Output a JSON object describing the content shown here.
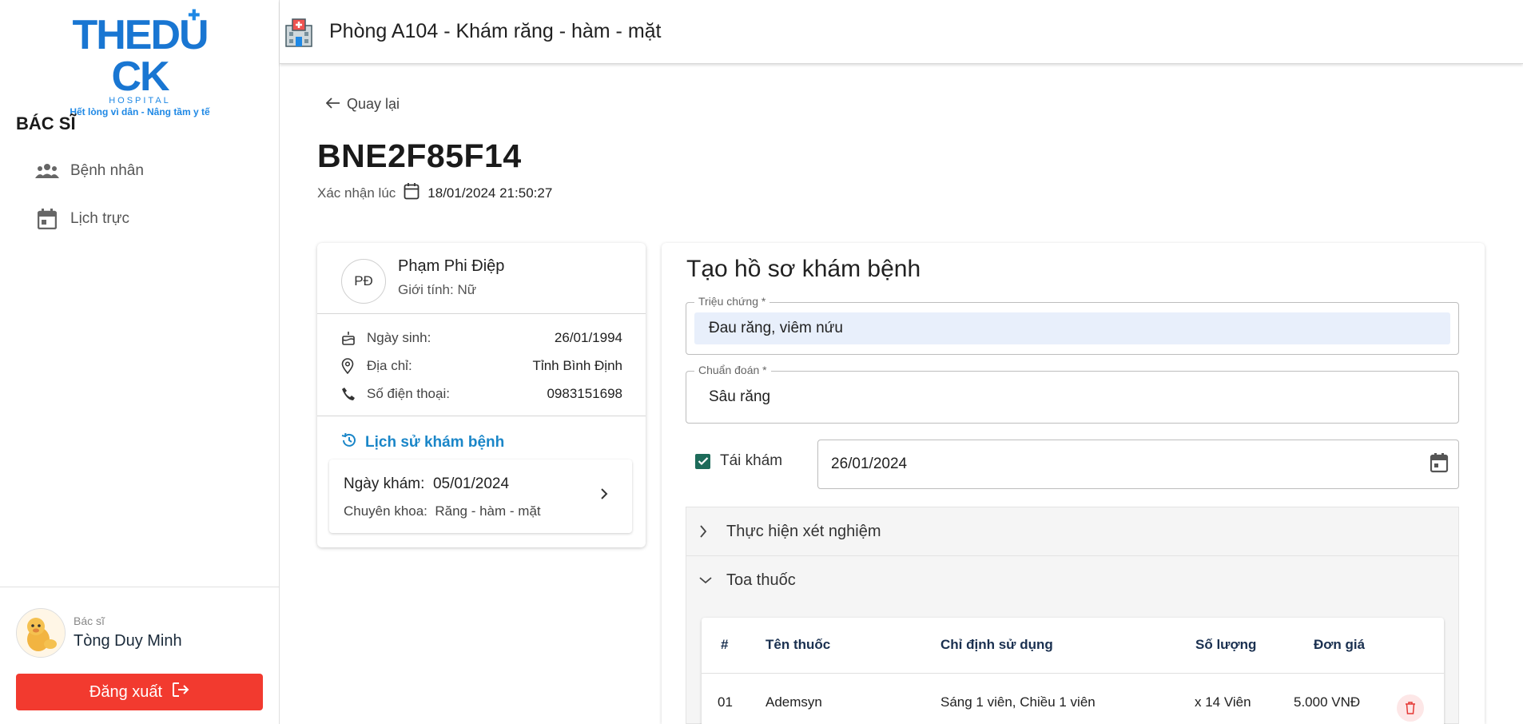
{
  "logo": {
    "main_the": "THE",
    "main_d": "D",
    "main_u": "U",
    "main_ck": "CK",
    "sub": "HOSPITAL",
    "slogan": "Hết lòng vì dân - Nâng tầm y tế"
  },
  "sidebar": {
    "role": "BÁC SĨ",
    "items": [
      {
        "label": "Bệnh nhân",
        "icon": "people-icon"
      },
      {
        "label": "Lịch trực",
        "icon": "calendar-icon"
      }
    ],
    "user": {
      "role": "Bác sĩ",
      "name": "Tòng Duy Minh"
    },
    "logout_label": "Đăng xuất"
  },
  "header": {
    "title": "Phòng A104 - Khám răng - hàm - mặt",
    "icon": "hospital-icon"
  },
  "page": {
    "back_label": "Quay lại",
    "code": "BNE2F85F14",
    "confirm_label": "Xác nhận lúc",
    "confirm_datetime": "18/01/2024 21:50:27"
  },
  "patient": {
    "initials": "PĐ",
    "name": "Phạm Phi Điệp",
    "gender": "Giới tính: Nữ",
    "dob_label": "Ngày sinh:",
    "dob": "26/01/1994",
    "address_label": "Địa chỉ:",
    "address": "Tỉnh Bình Định",
    "phone_label": "Số điện thoại:",
    "phone": "0983151698",
    "history_title": "Lịch sử khám bệnh",
    "history": [
      {
        "date_label": "Ngày khám:",
        "date": "05/01/2024",
        "spec_label": "Chuyên khoa:",
        "spec": "Răng - hàm - mặt"
      }
    ]
  },
  "form": {
    "title": "Tạo hồ sơ khám bệnh",
    "symptom_label": "Triệu chứng *",
    "symptom_value": "Đau răng, viêm nứu",
    "diagnosis_label": "Chuẩn đoán *",
    "diagnosis_value": "Sâu răng",
    "recheck_label": "Tái khám",
    "recheck_checked": true,
    "recheck_date": "26/01/2024",
    "test_section": "Thực hiện xét nghiệm",
    "rx_section": "Toa thuốc",
    "rx_table": {
      "headers": [
        "#",
        "Tên thuốc",
        "Chỉ định sử dụng",
        "Số lượng",
        "Đơn giá"
      ],
      "rows": [
        {
          "no": "01",
          "name": "Ademsyn",
          "usage": "Sáng 1 viên, Chiều 1 viên",
          "qty": "x 14 Viên",
          "price": "5.000 VNĐ"
        }
      ]
    }
  },
  "colors": {
    "primary_blue": "#1976d2",
    "logout_red": "#f23a2f",
    "history_blue": "#1a86c8",
    "checkbox_green": "#1d6b5a",
    "input_fill": "#e8effb"
  }
}
